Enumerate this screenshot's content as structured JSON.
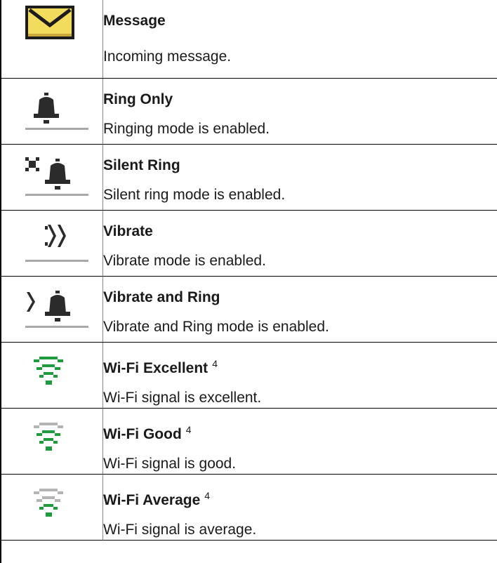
{
  "rows": [
    {
      "icon": "envelope-icon",
      "title": "Message",
      "sup": "",
      "desc": "Incoming message."
    },
    {
      "icon": "bell-icon",
      "title": "Ring Only",
      "sup": "",
      "desc": "Ringing mode is enabled."
    },
    {
      "icon": "silent-bell-icon",
      "title": "Silent Ring",
      "sup": "",
      "desc": "Silent ring mode is enabled."
    },
    {
      "icon": "vibrate-icon",
      "title": "Vibrate",
      "sup": "",
      "desc": "Vibrate mode is enabled."
    },
    {
      "icon": "vibrate-bell-icon",
      "title": "Vibrate and Ring",
      "sup": "",
      "desc": "Vibrate and Ring mode is enabled."
    },
    {
      "icon": "wifi-excellent-icon",
      "title": "Wi-Fi Excellent",
      "sup": "4",
      "desc": "Wi-Fi signal is excellent."
    },
    {
      "icon": "wifi-good-icon",
      "title": "Wi-Fi Good",
      "sup": "4",
      "desc": "Wi-Fi signal is good."
    },
    {
      "icon": "wifi-average-icon",
      "title": "Wi-Fi Average",
      "sup": "4",
      "desc": "Wi-Fi signal is average."
    }
  ],
  "colors": {
    "envelope_fill": "#f2dc5d",
    "envelope_border": "#1c1c1c",
    "icon_dark": "#2b2b2b",
    "icon_rule": "#a8a8a8",
    "wifi_green": "#1e9b3c",
    "wifi_grey": "#b4b4b4"
  }
}
